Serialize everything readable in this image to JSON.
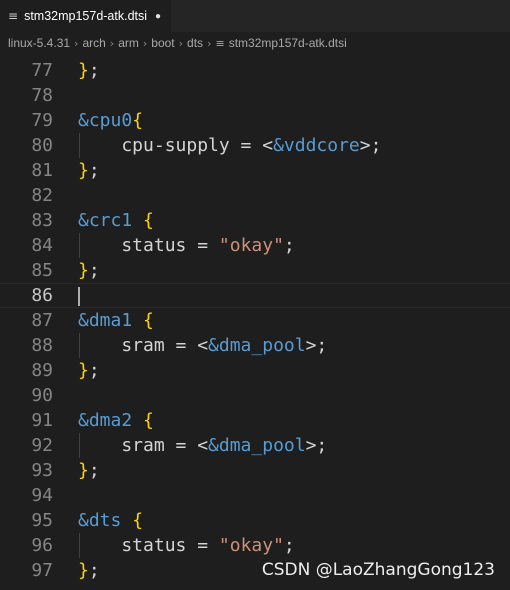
{
  "tab": {
    "filename": "stm32mp157d-atk.dtsi",
    "icon": "file-lines-icon",
    "dirty_glyph": "●"
  },
  "breadcrumb": {
    "parts": [
      "linux-5.4.31",
      "arch",
      "arm",
      "boot",
      "dts"
    ],
    "file": "stm32mp157d-atk.dtsi",
    "sep": "›",
    "file_icon_glyph": "≡"
  },
  "editor": {
    "current_line": "86",
    "lines": [
      {
        "num": "77",
        "guide": false,
        "tokens": [
          {
            "cls": "t-brace",
            "text": "}"
          },
          {
            "cls": "t-punct",
            "text": ";"
          }
        ]
      },
      {
        "num": "78",
        "guide": false,
        "tokens": []
      },
      {
        "num": "79",
        "guide": false,
        "tokens": [
          {
            "cls": "t-ref",
            "text": "&cpu0"
          },
          {
            "cls": "t-brace",
            "text": "{"
          }
        ]
      },
      {
        "num": "80",
        "guide": true,
        "tokens": [
          {
            "cls": "t-prop",
            "text": "    cpu-supply = <"
          },
          {
            "cls": "t-ref",
            "text": "&vddcore"
          },
          {
            "cls": "t-punct",
            "text": ">;"
          }
        ]
      },
      {
        "num": "81",
        "guide": false,
        "tokens": [
          {
            "cls": "t-brace",
            "text": "}"
          },
          {
            "cls": "t-punct",
            "text": ";"
          }
        ]
      },
      {
        "num": "82",
        "guide": false,
        "tokens": []
      },
      {
        "num": "83",
        "guide": false,
        "tokens": [
          {
            "cls": "t-ref",
            "text": "&crc1"
          },
          {
            "cls": "t-punct",
            "text": " "
          },
          {
            "cls": "t-brace",
            "text": "{"
          }
        ]
      },
      {
        "num": "84",
        "guide": true,
        "tokens": [
          {
            "cls": "t-prop",
            "text": "    status = "
          },
          {
            "cls": "t-str",
            "text": "\"okay\""
          },
          {
            "cls": "t-punct",
            "text": ";"
          }
        ]
      },
      {
        "num": "85",
        "guide": false,
        "tokens": [
          {
            "cls": "t-brace",
            "text": "}"
          },
          {
            "cls": "t-punct",
            "text": ";"
          }
        ]
      },
      {
        "num": "86",
        "guide": false,
        "tokens": []
      },
      {
        "num": "87",
        "guide": false,
        "tokens": [
          {
            "cls": "t-ref",
            "text": "&dma1"
          },
          {
            "cls": "t-punct",
            "text": " "
          },
          {
            "cls": "t-brace",
            "text": "{"
          }
        ]
      },
      {
        "num": "88",
        "guide": true,
        "tokens": [
          {
            "cls": "t-prop",
            "text": "    sram = <"
          },
          {
            "cls": "t-ref",
            "text": "&dma_pool"
          },
          {
            "cls": "t-punct",
            "text": ">;"
          }
        ]
      },
      {
        "num": "89",
        "guide": false,
        "tokens": [
          {
            "cls": "t-brace",
            "text": "}"
          },
          {
            "cls": "t-punct",
            "text": ";"
          }
        ]
      },
      {
        "num": "90",
        "guide": false,
        "tokens": []
      },
      {
        "num": "91",
        "guide": false,
        "tokens": [
          {
            "cls": "t-ref",
            "text": "&dma2"
          },
          {
            "cls": "t-punct",
            "text": " "
          },
          {
            "cls": "t-brace",
            "text": "{"
          }
        ]
      },
      {
        "num": "92",
        "guide": true,
        "tokens": [
          {
            "cls": "t-prop",
            "text": "    sram = <"
          },
          {
            "cls": "t-ref",
            "text": "&dma_pool"
          },
          {
            "cls": "t-punct",
            "text": ">;"
          }
        ]
      },
      {
        "num": "93",
        "guide": false,
        "tokens": [
          {
            "cls": "t-brace",
            "text": "}"
          },
          {
            "cls": "t-punct",
            "text": ";"
          }
        ]
      },
      {
        "num": "94",
        "guide": false,
        "tokens": []
      },
      {
        "num": "95",
        "guide": false,
        "tokens": [
          {
            "cls": "t-ref",
            "text": "&dts"
          },
          {
            "cls": "t-punct",
            "text": " "
          },
          {
            "cls": "t-brace",
            "text": "{"
          }
        ]
      },
      {
        "num": "96",
        "guide": true,
        "tokens": [
          {
            "cls": "t-prop",
            "text": "    status = "
          },
          {
            "cls": "t-str",
            "text": "\"okay\""
          },
          {
            "cls": "t-punct",
            "text": ";"
          }
        ]
      },
      {
        "num": "97",
        "guide": false,
        "tokens": [
          {
            "cls": "t-brace",
            "text": "}"
          },
          {
            "cls": "t-punct",
            "text": ";"
          }
        ]
      }
    ]
  },
  "watermark": "CSDN @LaoZhangGong123",
  "colors": {
    "background": "#1e1e1e",
    "keyword_ref": "#569cd6",
    "brace": "#ffd700",
    "string": "#ce9178",
    "line_number": "#858585"
  }
}
